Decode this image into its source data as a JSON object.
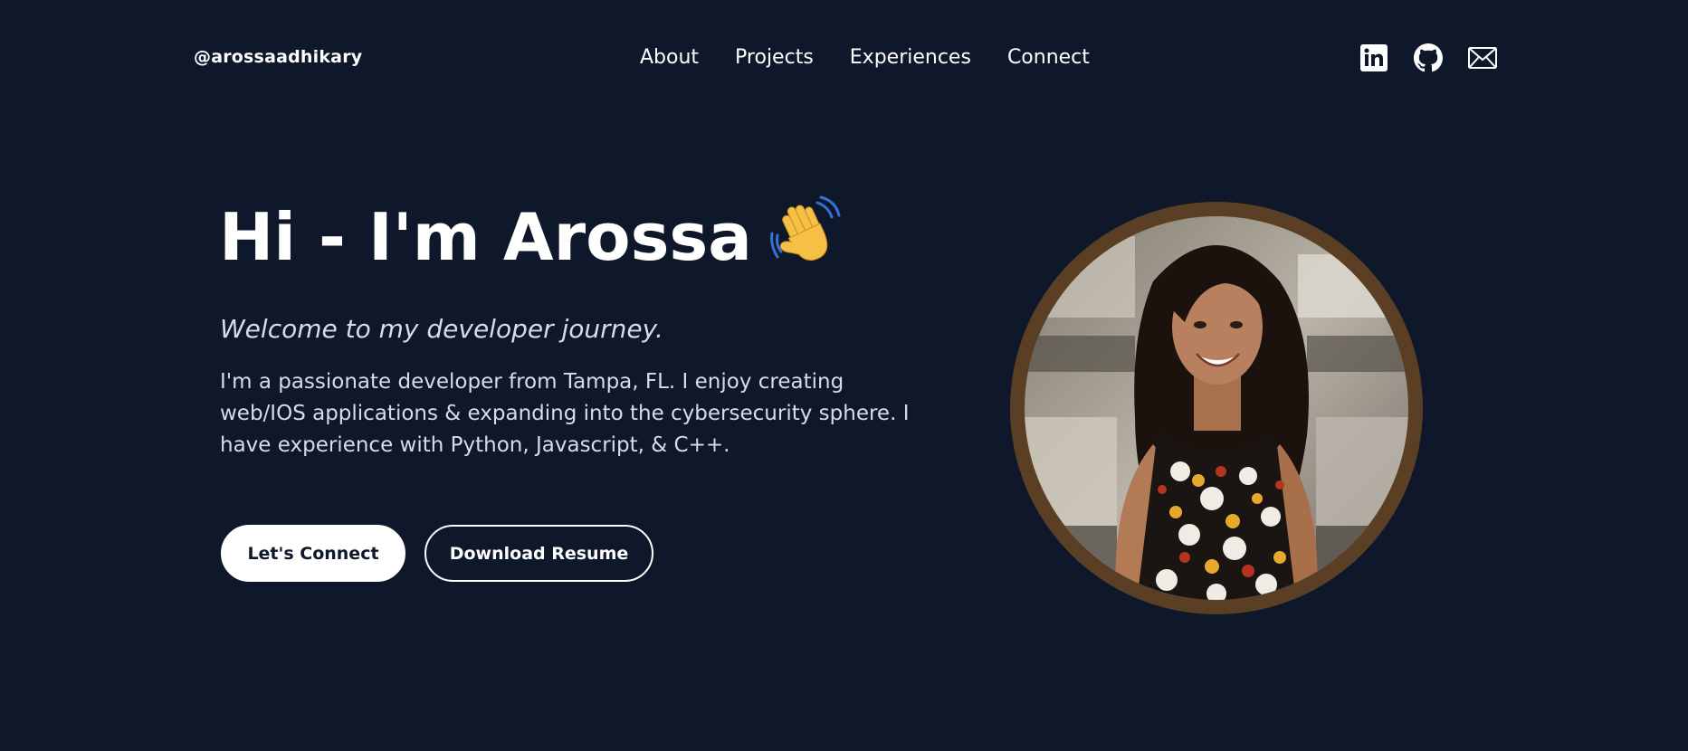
{
  "header": {
    "brand": "@arossaadhikary",
    "nav": [
      {
        "label": "About"
      },
      {
        "label": "Projects"
      },
      {
        "label": "Experiences"
      },
      {
        "label": "Connect"
      }
    ],
    "socials": [
      {
        "icon": "linkedin-icon"
      },
      {
        "icon": "github-icon"
      },
      {
        "icon": "mail-icon"
      }
    ]
  },
  "hero": {
    "title": "Hi - I'm Arossa",
    "wave_icon": "waving-hand-icon",
    "subtitle": "Welcome to my developer journey.",
    "bio": "I'm a passionate developer from Tampa, FL. I enjoy creating web/IOS applications & expanding into the cybersecurity sphere. I have experience with Python, Javascript, & C++.",
    "primary_button": "Let's Connect",
    "secondary_button": "Download Resume"
  },
  "colors": {
    "background": "#0f172a",
    "text": "#ffffff",
    "muted_text": "#d6dcef",
    "portrait_ring": "#5a3f25"
  }
}
